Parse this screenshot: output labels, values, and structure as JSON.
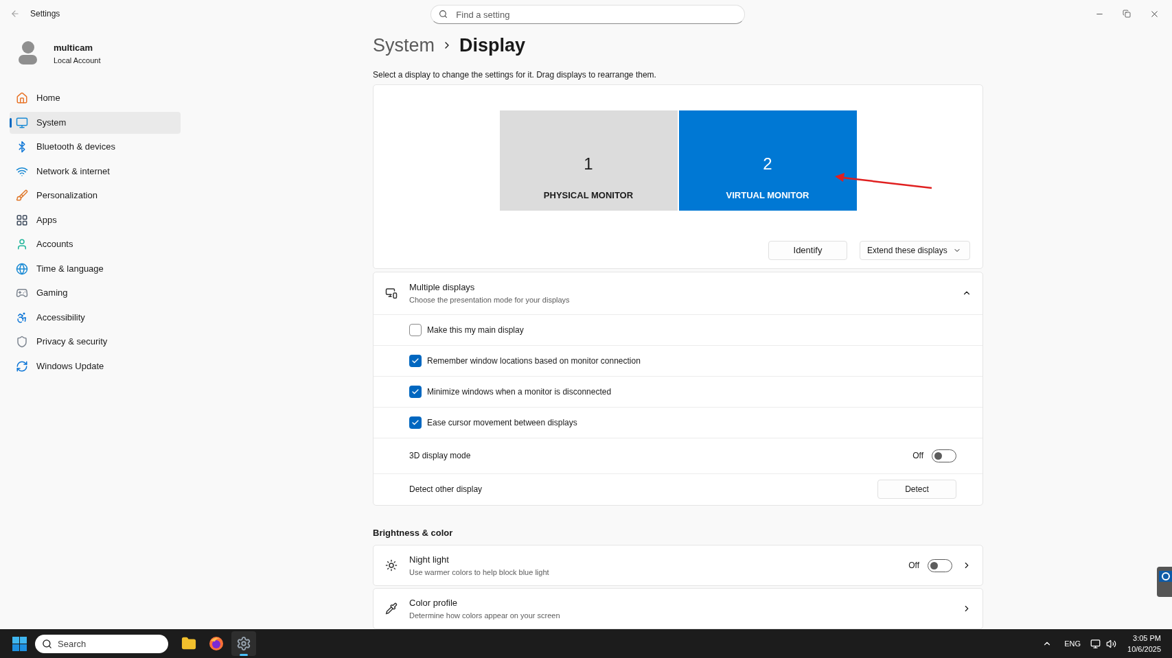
{
  "window": {
    "title": "Settings"
  },
  "search": {
    "placeholder": "Find a setting"
  },
  "account": {
    "name": "multicam",
    "type": "Local Account"
  },
  "nav": [
    {
      "label": "Home",
      "selected": false
    },
    {
      "label": "System",
      "selected": true
    },
    {
      "label": "Bluetooth & devices",
      "selected": false
    },
    {
      "label": "Network & internet",
      "selected": false
    },
    {
      "label": "Personalization",
      "selected": false
    },
    {
      "label": "Apps",
      "selected": false
    },
    {
      "label": "Accounts",
      "selected": false
    },
    {
      "label": "Time & language",
      "selected": false
    },
    {
      "label": "Gaming",
      "selected": false
    },
    {
      "label": "Accessibility",
      "selected": false
    },
    {
      "label": "Privacy & security",
      "selected": false
    },
    {
      "label": "Windows Update",
      "selected": false
    }
  ],
  "breadcrumb": {
    "parent": "System",
    "current": "Display"
  },
  "instructions": "Select a display to change the settings for it. Drag displays to rearrange them.",
  "monitors": [
    {
      "number": "1",
      "label": "PHYSICAL MONITOR",
      "selected": false
    },
    {
      "number": "2",
      "label": "VIRTUAL MONITOR",
      "selected": true
    }
  ],
  "display_actions": {
    "identify": "Identify",
    "mode": "Extend these displays"
  },
  "multiple_displays": {
    "title": "Multiple displays",
    "subtitle": "Choose the presentation mode for your displays",
    "expanded": true,
    "rows": [
      {
        "kind": "checkbox",
        "label": "Make this my main display",
        "checked": false
      },
      {
        "kind": "checkbox",
        "label": "Remember window locations based on monitor connection",
        "checked": true
      },
      {
        "kind": "checkbox",
        "label": "Minimize windows when a monitor is disconnected",
        "checked": true
      },
      {
        "kind": "checkbox",
        "label": "Ease cursor movement between displays",
        "checked": true
      },
      {
        "kind": "toggle",
        "label": "3D display mode",
        "state": "Off",
        "on": false
      },
      {
        "kind": "button",
        "label": "Detect other display",
        "button": "Detect"
      }
    ]
  },
  "brightness": {
    "heading": "Brightness & color",
    "rows": [
      {
        "kind": "toggle",
        "title": "Night light",
        "subtitle": "Use warmer colors to help block blue light",
        "state": "Off",
        "on": false
      },
      {
        "kind": "link",
        "title": "Color profile",
        "subtitle": "Determine how colors appear on your screen"
      }
    ]
  },
  "taskbar": {
    "search": {
      "placeholder": "Search"
    },
    "apps": [
      {
        "selected": false
      },
      {
        "selected": false
      },
      {
        "selected": true
      }
    ],
    "language": "ENG",
    "time": "3:05 PM",
    "date": "10/6/2025"
  }
}
